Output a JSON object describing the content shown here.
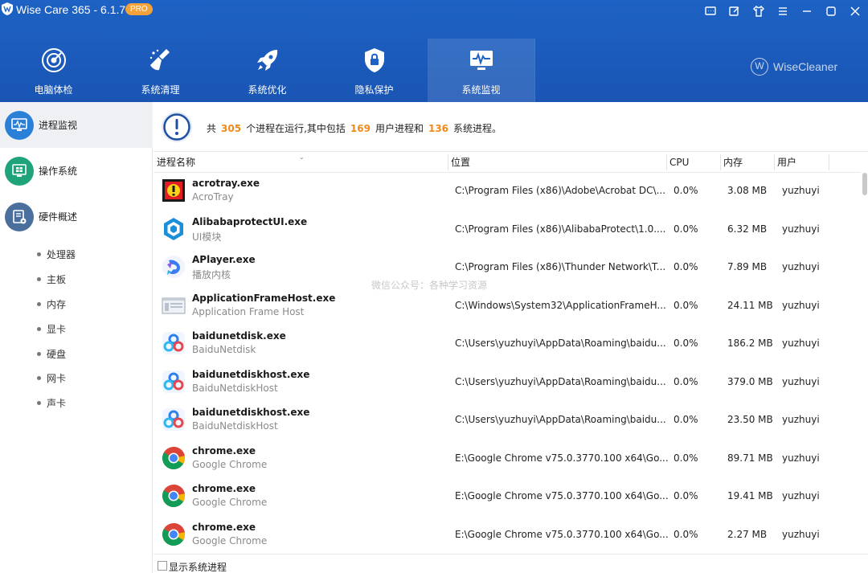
{
  "app": {
    "title": "Wise Care 365 - 6.1.7",
    "badge": "PRO",
    "brand": "WiseCleaner",
    "brand_mark": "W"
  },
  "window_controls": [
    "feedback-icon",
    "edit-icon",
    "skin-icon",
    "menu-icon",
    "minimize-icon",
    "maximize-icon",
    "close-icon"
  ],
  "nav": {
    "tabs": [
      {
        "label": "电脑体检",
        "icon": "radar-icon",
        "active": false
      },
      {
        "label": "系统清理",
        "icon": "broom-icon",
        "active": false
      },
      {
        "label": "系统优化",
        "icon": "rocket-icon",
        "active": false
      },
      {
        "label": "隐私保护",
        "icon": "shield-lock-icon",
        "active": false
      },
      {
        "label": "系统监视",
        "icon": "monitor-pulse-icon",
        "active": true
      }
    ]
  },
  "sidebar": {
    "items": [
      {
        "label": "进程监视",
        "icon": "monitor-icon",
        "active": true
      },
      {
        "label": "操作系统",
        "icon": "windows-icon",
        "active": false
      },
      {
        "label": "硬件概述",
        "icon": "hardware-icon",
        "active": false
      }
    ],
    "sub_items": [
      "处理器",
      "主板",
      "内存",
      "显卡",
      "硬盘",
      "网卡",
      "声卡"
    ]
  },
  "summary": {
    "prefix": "共",
    "total": "305",
    "mid1": "个进程在运行,其中包括",
    "user_count": "169",
    "mid2": "用户进程和",
    "system_count": "136",
    "suffix": "系统进程。"
  },
  "table": {
    "columns": [
      "进程名称",
      "位置",
      "CPU",
      "内存",
      "用户"
    ],
    "rows": [
      {
        "name": "acrotray.exe",
        "desc": "AcroTray",
        "location": "C:\\Program Files (x86)\\Adobe\\Acrobat DC\\...",
        "cpu": "0.0%",
        "mem": "3.08 MB",
        "user": "yuzhuyi",
        "icon": "acrotray-icon"
      },
      {
        "name": "AlibabaprotectUI.exe",
        "desc": "UI模块",
        "location": "C:\\Program Files (x86)\\AlibabaProtect\\1.0....",
        "cpu": "0.0%",
        "mem": "6.32 MB",
        "user": "yuzhuyi",
        "icon": "alibaba-protect-icon"
      },
      {
        "name": "APlayer.exe",
        "desc": "播放内核",
        "location": "C:\\Program Files (x86)\\Thunder Network\\T...",
        "cpu": "0.0%",
        "mem": "7.89 MB",
        "user": "yuzhuyi",
        "icon": "aplayer-icon"
      },
      {
        "name": "ApplicationFrameHost.exe",
        "desc": "Application Frame Host",
        "location": "C:\\Windows\\System32\\ApplicationFrameH...",
        "cpu": "0.0%",
        "mem": "24.11 MB",
        "user": "yuzhuyi",
        "icon": "application-frame-icon"
      },
      {
        "name": "baidunetdisk.exe",
        "desc": "BaiduNetdisk",
        "location": "C:\\Users\\yuzhuyi\\AppData\\Roaming\\baidu...",
        "cpu": "0.0%",
        "mem": "186.2 MB",
        "user": "yuzhuyi",
        "icon": "baidu-netdisk-icon"
      },
      {
        "name": "baidunetdiskhost.exe",
        "desc": "BaiduNetdiskHost",
        "location": "C:\\Users\\yuzhuyi\\AppData\\Roaming\\baidu...",
        "cpu": "0.0%",
        "mem": "379.0 MB",
        "user": "yuzhuyi",
        "icon": "baidu-netdisk-icon"
      },
      {
        "name": "baidunetdiskhost.exe",
        "desc": "BaiduNetdiskHost",
        "location": "C:\\Users\\yuzhuyi\\AppData\\Roaming\\baidu...",
        "cpu": "0.0%",
        "mem": "23.50 MB",
        "user": "yuzhuyi",
        "icon": "baidu-netdisk-icon"
      },
      {
        "name": "chrome.exe",
        "desc": "Google Chrome",
        "location": "E:\\Google Chrome v75.0.3770.100 x64\\Go...",
        "cpu": "0.0%",
        "mem": "89.71 MB",
        "user": "yuzhuyi",
        "icon": "chrome-icon"
      },
      {
        "name": "chrome.exe",
        "desc": "Google Chrome",
        "location": "E:\\Google Chrome v75.0.3770.100 x64\\Go...",
        "cpu": "0.0%",
        "mem": "19.41 MB",
        "user": "yuzhuyi",
        "icon": "chrome-icon"
      },
      {
        "name": "chrome.exe",
        "desc": "Google Chrome",
        "location": "E:\\Google Chrome v75.0.3770.100 x64\\Go...",
        "cpu": "0.0%",
        "mem": "2.27 MB",
        "user": "yuzhuyi",
        "icon": "chrome-icon"
      }
    ]
  },
  "footer": {
    "show_system_label": "显示系统进程",
    "checked": false
  },
  "watermark": "微信公众号：各种学习资源",
  "colors": {
    "header": "#1d62c4",
    "accent_orange": "#ef8a1a",
    "badge": "#f3a23a"
  }
}
